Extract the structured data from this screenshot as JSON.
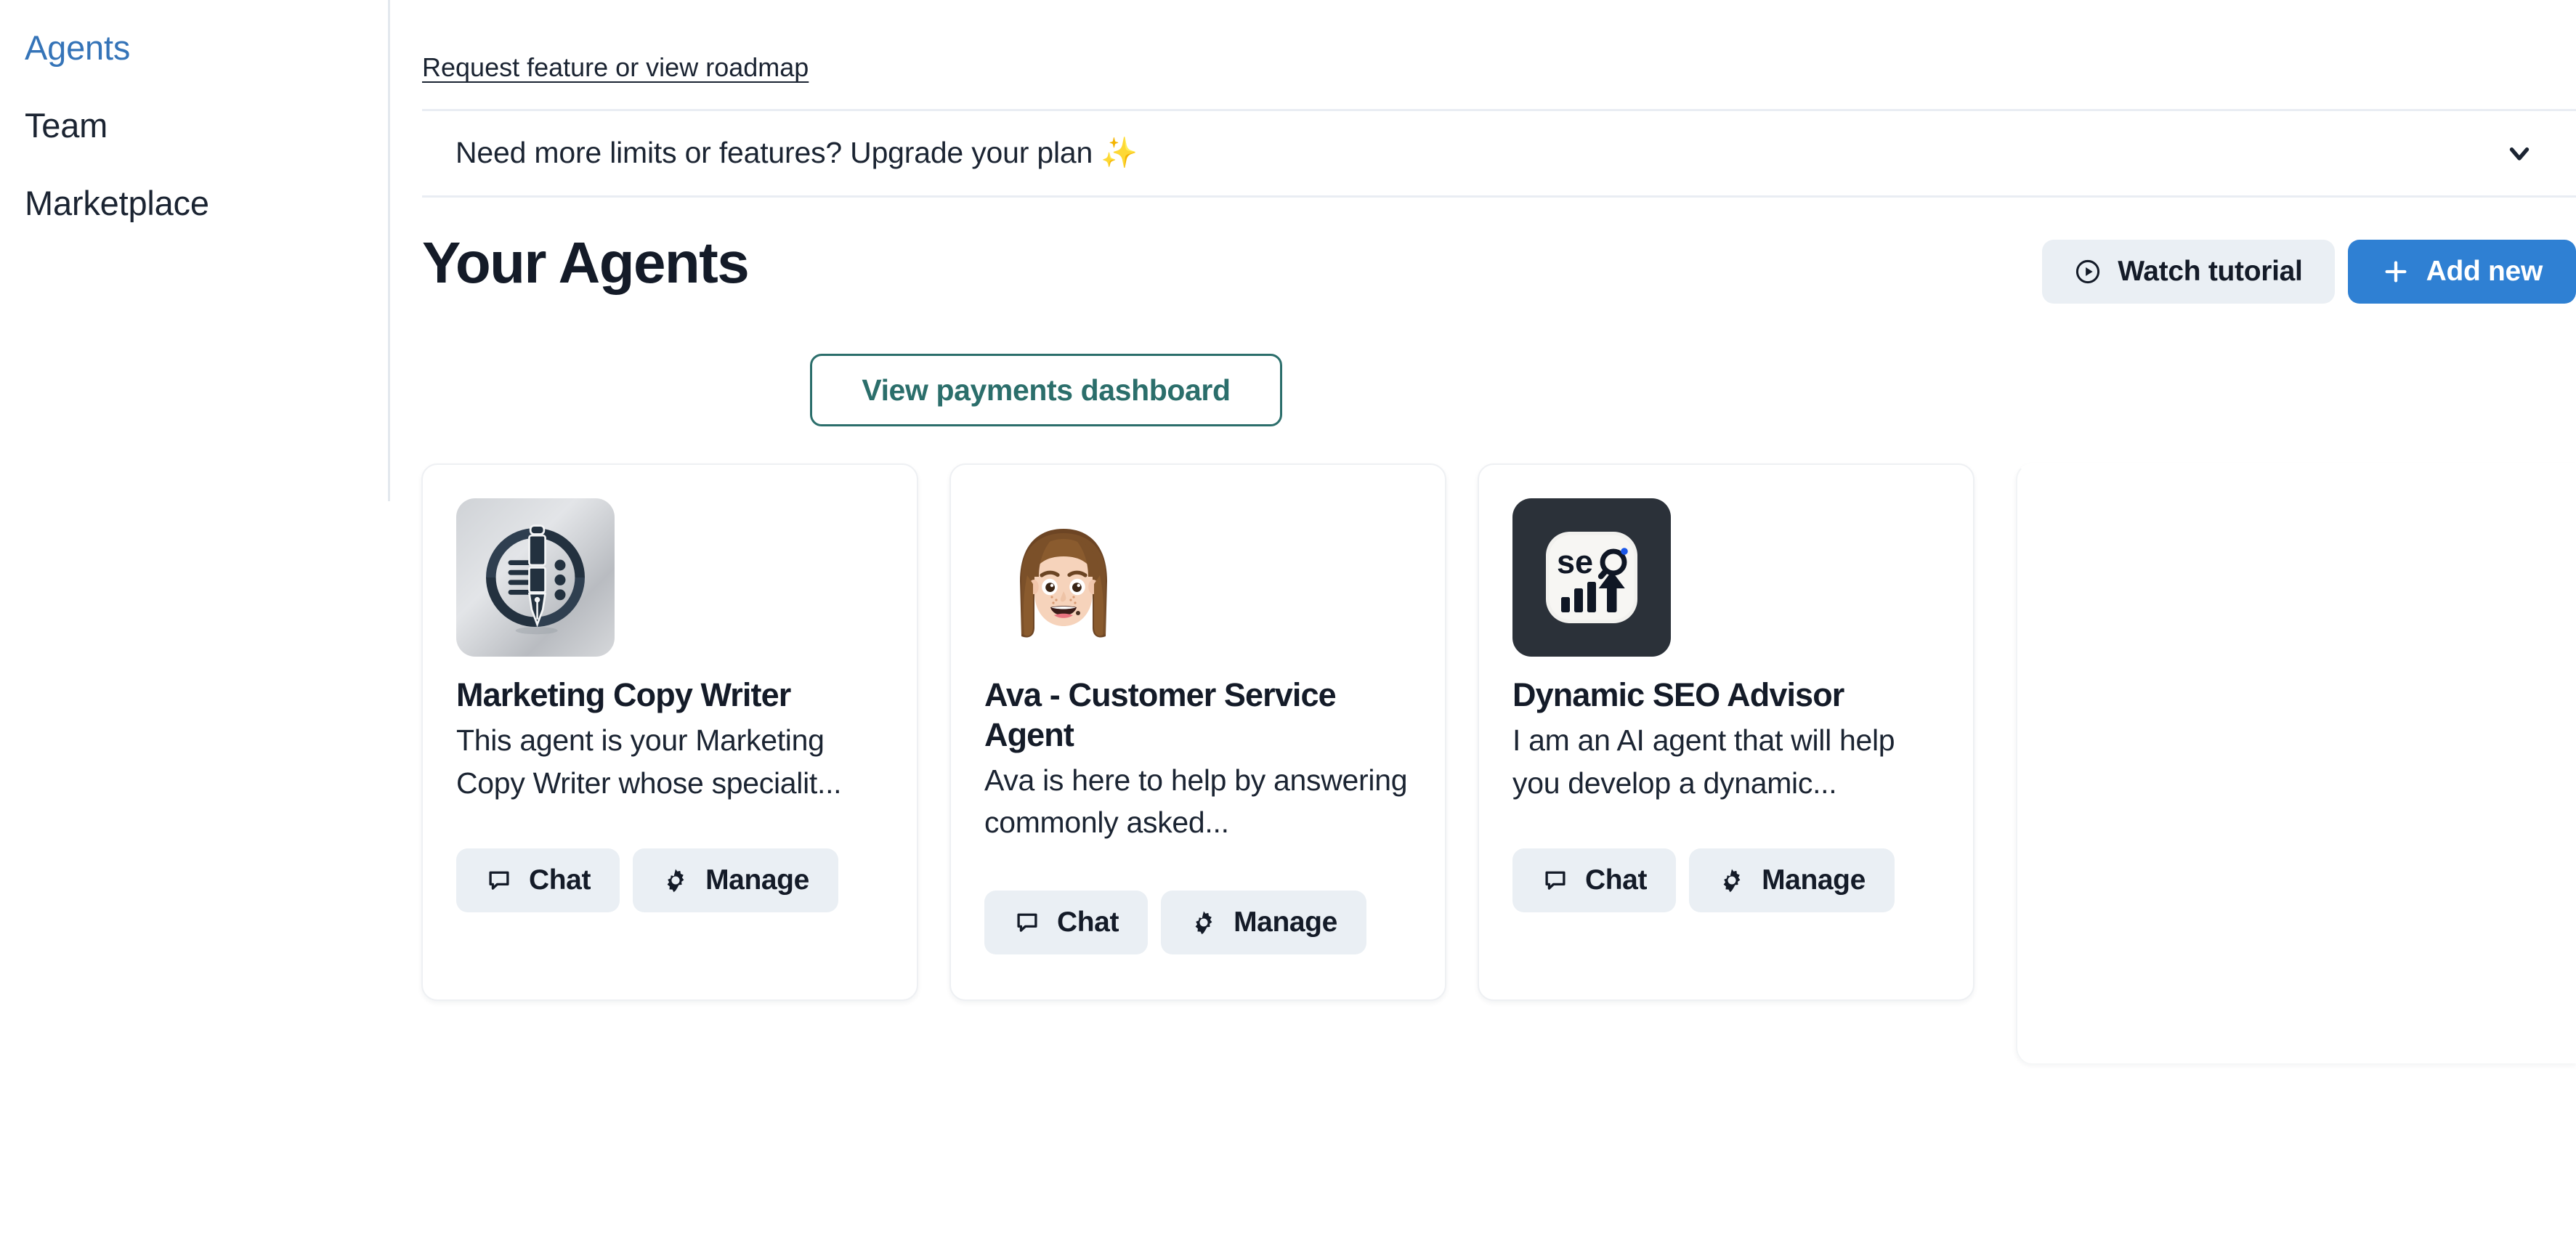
{
  "sidebar": {
    "items": [
      {
        "label": "Agents",
        "active": true
      },
      {
        "label": "Team",
        "active": false
      },
      {
        "label": "Marketplace",
        "active": false
      }
    ]
  },
  "header": {
    "roadmap_link": "Request feature or view roadmap",
    "upgrade_banner": "Need more limits or features? Upgrade your plan ✨",
    "chevron_icon": "chevron-down-icon"
  },
  "page": {
    "title": "Your Agents",
    "watch_tutorial_label": "Watch tutorial",
    "watch_tutorial_icon": "play-circle-icon",
    "add_new_label": "Add new",
    "add_new_icon": "plus-icon",
    "payments_dashboard_label": "View payments dashboard"
  },
  "colors": {
    "accent_blue": "#2f80d3",
    "link_blue": "#3574b8",
    "teal": "#2b6e6b",
    "text_dark": "#141b28",
    "button_bg": "#eaeff4",
    "border": "#eef0f3"
  },
  "agents": [
    {
      "name": "Marketing Copy Writer",
      "description": "This agent is your Marketing Copy Writer whose specialit...",
      "avatar": "pen-badge-avatar",
      "chat_label": "Chat",
      "chat_icon": "chat-bubble-icon",
      "manage_label": "Manage",
      "manage_icon": "gear-icon"
    },
    {
      "name": "Ava - Customer Service Agent",
      "description": "Ava is here to help by answering commonly asked...",
      "avatar": "memoji-woman-avatar",
      "chat_label": "Chat",
      "chat_icon": "chat-bubble-icon",
      "manage_label": "Manage",
      "manage_icon": "gear-icon"
    },
    {
      "name": "Dynamic SEO Advisor",
      "description": "I am an AI agent that will help you develop a dynamic...",
      "avatar": "seo-tile-avatar",
      "chat_label": "Chat",
      "chat_icon": "chat-bubble-icon",
      "manage_label": "Manage",
      "manage_icon": "gear-icon"
    }
  ]
}
